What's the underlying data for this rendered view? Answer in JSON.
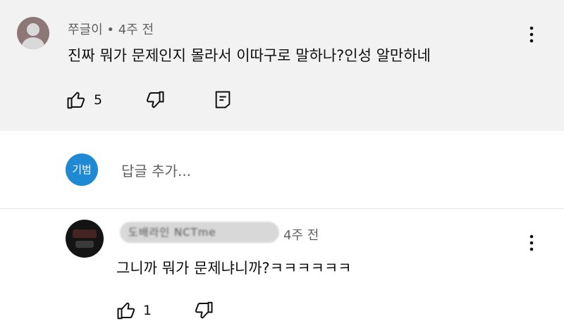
{
  "top_comment": {
    "author": "쭈글이",
    "separator": " • ",
    "time": "4주 전",
    "text": "진짜 뭐가 문제인지 몰라서 이따구로 말하나?인성 알만하네",
    "like_count": "5",
    "icons": [
      "like-icon",
      "dislike-icon",
      "reply-icon",
      "more-options-icon"
    ]
  },
  "reply_box": {
    "avatar_text": "기범",
    "placeholder": "답글 추가..."
  },
  "reply_comment": {
    "author_blurred": "도배라인 NCTme",
    "time": "4주 전",
    "text": "그니까 뭐가 문제냐니까?ㅋㅋㅋㅋㅋㅋ",
    "like_count": "1",
    "icons": [
      "like-icon",
      "dislike-icon",
      "more-options-icon"
    ]
  },
  "colors": {
    "highlight_bg": "#f2f2f2",
    "avatar_blue": "#1f89d4",
    "secondary_text": "#606060"
  }
}
